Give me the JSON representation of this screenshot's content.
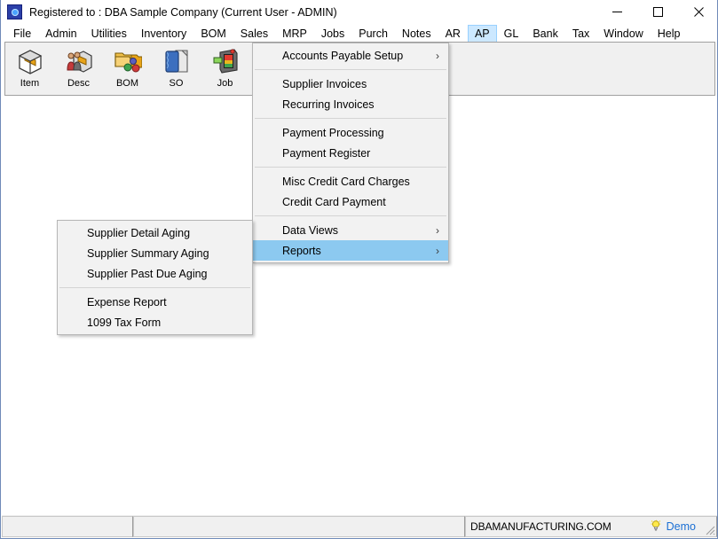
{
  "window": {
    "title": "Registered to : DBA Sample Company (Current User - ADMIN)",
    "icon": "app-gear-icon",
    "minimize_label": "—",
    "maximize_label": "□",
    "close_label": "✕"
  },
  "menubar": {
    "items": [
      {
        "label": "File",
        "active": false
      },
      {
        "label": "Admin",
        "active": false
      },
      {
        "label": "Utilities",
        "active": false
      },
      {
        "label": "Inventory",
        "active": false
      },
      {
        "label": "BOM",
        "active": false
      },
      {
        "label": "Sales",
        "active": false
      },
      {
        "label": "MRP",
        "active": false
      },
      {
        "label": "Jobs",
        "active": false
      },
      {
        "label": "Purch",
        "active": false
      },
      {
        "label": "Notes",
        "active": false
      },
      {
        "label": "AR",
        "active": false
      },
      {
        "label": "AP",
        "active": true
      },
      {
        "label": "GL",
        "active": false
      },
      {
        "label": "Bank",
        "active": false
      },
      {
        "label": "Tax",
        "active": false
      },
      {
        "label": "Window",
        "active": false
      },
      {
        "label": "Help",
        "active": false
      }
    ]
  },
  "toolbar": {
    "buttons": [
      {
        "label": "Item",
        "icon": "box-icon"
      },
      {
        "label": "Desc",
        "icon": "people-box-icon"
      },
      {
        "label": "BOM",
        "icon": "folder-tree-icon"
      },
      {
        "label": "SO",
        "icon": "notepad-icon"
      },
      {
        "label": "Job",
        "icon": "machine-icon"
      }
    ]
  },
  "ap_menu": {
    "name": "accounts-payable-menu",
    "items": [
      {
        "label": "Accounts Payable Setup",
        "submenu": true,
        "selected": false
      },
      {
        "separator": true
      },
      {
        "label": "Supplier Invoices",
        "submenu": false,
        "selected": false
      },
      {
        "label": "Recurring Invoices",
        "submenu": false,
        "selected": false
      },
      {
        "separator": true
      },
      {
        "label": "Payment Processing",
        "submenu": false,
        "selected": false
      },
      {
        "label": "Payment Register",
        "submenu": false,
        "selected": false
      },
      {
        "separator": true
      },
      {
        "label": "Misc Credit Card Charges",
        "submenu": false,
        "selected": false
      },
      {
        "label": "Credit Card Payment",
        "submenu": false,
        "selected": false
      },
      {
        "separator": true
      },
      {
        "label": "Data Views",
        "submenu": true,
        "selected": false
      },
      {
        "label": "Reports",
        "submenu": true,
        "selected": true
      }
    ]
  },
  "reports_submenu": {
    "name": "ap-reports-submenu",
    "items": [
      {
        "label": "Supplier Detail Aging",
        "selected": false
      },
      {
        "label": "Supplier Summary Aging",
        "selected": false
      },
      {
        "label": "Supplier Past Due Aging",
        "selected": false
      },
      {
        "separator": true
      },
      {
        "label": "Expense Report",
        "selected": false
      },
      {
        "label": "1099 Tax Form",
        "selected": false
      }
    ]
  },
  "statusbar": {
    "panel1": "",
    "panel2": "",
    "domain": "DBAMANUFACTURING.COM",
    "demo_label": "Demo",
    "demo_color": "#1a6fd4",
    "bulb_icon": "lightbulb-icon"
  },
  "colors": {
    "menu_highlight": "#8cc9f0",
    "menubar_active": "#cce8ff",
    "toolbar_bg": "#f0f0f0",
    "window_border": "#6f8ab8",
    "popup_bg": "#f2f2f2"
  }
}
